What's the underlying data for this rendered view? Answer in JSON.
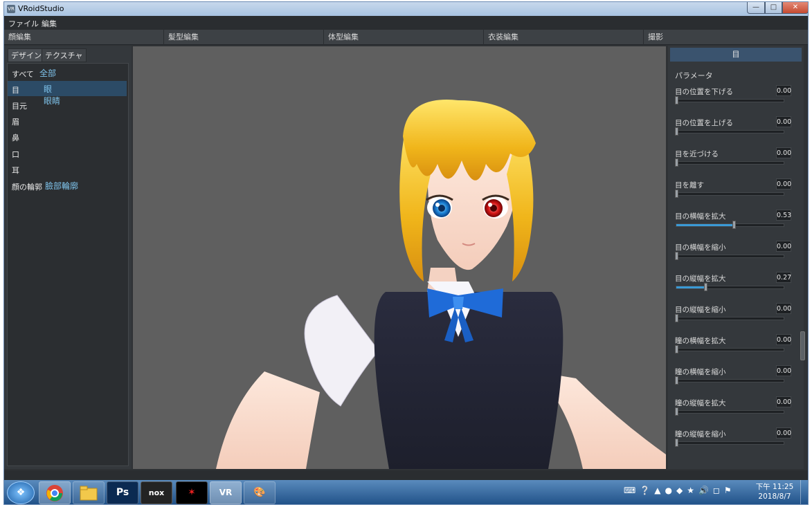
{
  "window": {
    "title": "VRoidStudio",
    "app_icon": "vroid-icon"
  },
  "menubar": {
    "file": "ファイル",
    "edit": "編集"
  },
  "categories": [
    "顔編集",
    "髪型編集",
    "体型編集",
    "衣装編集",
    "撮影"
  ],
  "left_panel": {
    "tabs": [
      "デザイン",
      "テクスチャ"
    ],
    "items": [
      {
        "label": "すべて",
        "sub": "全部"
      },
      {
        "label": "目",
        "sub": "眼",
        "sub2": ""
      },
      {
        "label": "目元",
        "sub": "眼睛"
      },
      {
        "label": "眉",
        "sub": ""
      },
      {
        "label": "鼻",
        "sub": ""
      },
      {
        "label": "口",
        "sub": ""
      },
      {
        "label": "耳",
        "sub": ""
      },
      {
        "label": "顔の輪郭",
        "sub": "臉部輪廓"
      }
    ]
  },
  "right_panel": {
    "header": "目",
    "section": "パラメータ",
    "params": [
      {
        "label": "目の位置を下げる",
        "value": "0.00",
        "level": 0.0
      },
      {
        "label": "目の位置を上げる",
        "value": "0.00",
        "level": 0.0
      },
      {
        "label": "目を近づける",
        "value": "0.00",
        "level": 0.0
      },
      {
        "label": "目を離す",
        "value": "0.00",
        "level": 0.0
      },
      {
        "label": "目の横幅を拡大",
        "value": "0.53",
        "level": 0.53
      },
      {
        "label": "目の横幅を縮小",
        "value": "0.00",
        "level": 0.0
      },
      {
        "label": "目の縦幅を拡大",
        "value": "0.27",
        "level": 0.27
      },
      {
        "label": "目の縦幅を縮小",
        "value": "0.00",
        "level": 0.0
      },
      {
        "label": "瞳の横幅を拡大",
        "value": "0.00",
        "level": 0.0
      },
      {
        "label": "瞳の横幅を縮小",
        "value": "0.00",
        "level": 0.0
      },
      {
        "label": "瞳の縦幅を拡大",
        "value": "0.00",
        "level": 0.0
      },
      {
        "label": "瞳の縦幅を縮小",
        "value": "0.00",
        "level": 0.0
      }
    ]
  },
  "taskbar": {
    "apps": [
      "start-orb-icon",
      "chrome-icon",
      "file-explorer-icon",
      "photoshop-icon",
      "nox-icon",
      "garena-icon",
      "vroid-icon",
      "paint-icon"
    ],
    "labels": {
      "ps": "Ps",
      "nox": "nox",
      "vr": "VR"
    },
    "clock_time": "下午 11:25",
    "clock_date": "2018/8/7"
  },
  "colors": {
    "accent": "#3a9ad6",
    "selection": "#2c4b66",
    "sub_text": "#7ec2ea"
  }
}
